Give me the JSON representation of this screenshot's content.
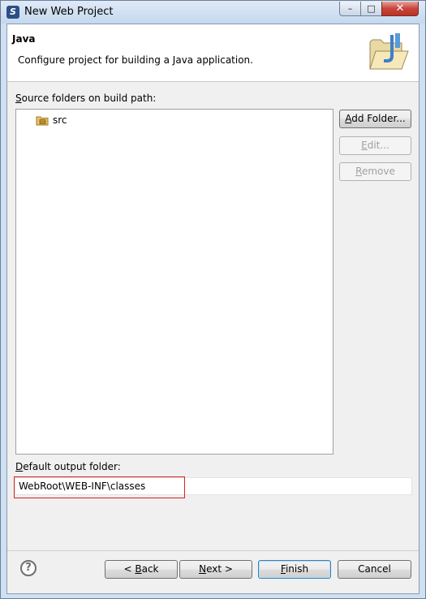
{
  "window": {
    "title": "New Web Project",
    "minimize_glyph": "–",
    "maximize_glyph": "□",
    "close_glyph": "✕"
  },
  "banner": {
    "title": "Java",
    "description": "Configure project for building a Java application."
  },
  "source_folders": {
    "label_first": "S",
    "label_rest": "ource folders on build path:",
    "items": [
      {
        "label": "src",
        "icon": "package-folder-icon"
      }
    ]
  },
  "side_buttons": {
    "add_folder_first": "A",
    "add_folder_rest": "dd Folder...",
    "edit_first": "E",
    "edit_rest": "dit...",
    "remove_first": "R",
    "remove_rest": "emove"
  },
  "output": {
    "label_first": "D",
    "label_rest": "efault output folder:",
    "value": "WebRoot\\WEB-INF\\classes"
  },
  "footer": {
    "help_glyph": "?",
    "back_prefix": "< ",
    "back_first": "B",
    "back_rest": "ack",
    "next_first": "N",
    "next_rest": "ext >",
    "finish_first": "F",
    "finish_rest": "inish",
    "cancel": "Cancel"
  },
  "colors": {
    "highlight": "#e02020",
    "titlebar": "#c5d8ee",
    "close_button": "#c7453b"
  }
}
